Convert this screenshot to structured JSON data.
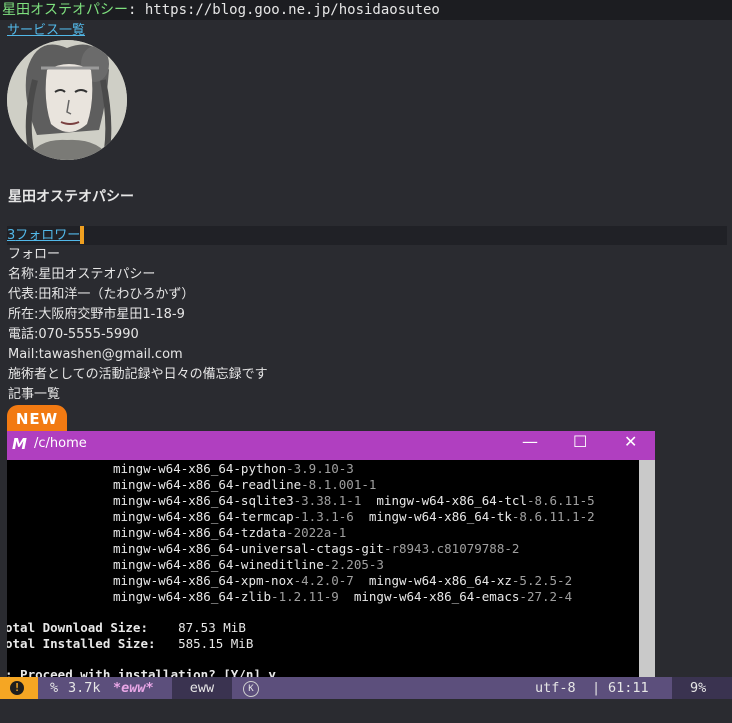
{
  "header": {
    "site_name": "星田オステオパシー",
    "separator": ": ",
    "url": "https://blog.goo.ne.jp/hosidaosuteo"
  },
  "nav": {
    "service_list_link": "サービス一覧"
  },
  "profile": {
    "blog_title": "星田オステオパシー",
    "followers_count": "3",
    "followers_label": "フォロワー",
    "follow_label": "フォロー",
    "info_lines": [
      "名称:星田オステオパシー",
      "代表:田和洋一（たわひろかず）",
      "所在:大阪府交野市星田1-18-9",
      "電話:070-5555-5990",
      "Mail:tawashen@gmail.com",
      "施術者としての活動記録や日々の備忘録です",
      "記事一覧"
    ],
    "new_badge": "NEW"
  },
  "terminal": {
    "logo": "M",
    "path": "/c/home",
    "window_buttons": {
      "minimize": "—",
      "maximize": "☐",
      "close": "✕"
    },
    "packages": [
      {
        "col1": "mingw-w64-x86_64-python",
        "ver1": "-3.9.10-3",
        "col2": "",
        "ver2": ""
      },
      {
        "col1": "mingw-w64-x86_64-readline",
        "ver1": "-8.1.001-1",
        "col2": "",
        "ver2": ""
      },
      {
        "col1": "mingw-w64-x86_64-sqlite3",
        "ver1": "-3.38.1-1",
        "col2": "mingw-w64-x86_64-tcl",
        "ver2": "-8.6.11-5"
      },
      {
        "col1": "mingw-w64-x86_64-termcap",
        "ver1": "-1.3.1-6",
        "col2": "mingw-w64-x86_64-tk",
        "ver2": "-8.6.11.1-2"
      },
      {
        "col1": "mingw-w64-x86_64-tzdata",
        "ver1": "-2022a-1",
        "col2": "",
        "ver2": ""
      },
      {
        "col1": "mingw-w64-x86_64-universal-ctags-git",
        "ver1": "-r8943.c81079788-2",
        "col2": "",
        "ver2": ""
      },
      {
        "col1": "mingw-w64-x86_64-wineditline",
        "ver1": "-2.205-3",
        "col2": "",
        "ver2": ""
      },
      {
        "col1": "mingw-w64-x86_64-xpm-nox",
        "ver1": "-4.2.0-7",
        "col2": "mingw-w64-x86_64-xz",
        "ver2": "-5.2.5-2"
      },
      {
        "col1": "mingw-w64-x86_64-zlib",
        "ver1": "-1.2.11-9",
        "col2": "mingw-w64-x86_64-emacs",
        "ver2": "-27.2-4"
      }
    ],
    "download_size_label": "otal Download Size:",
    "download_size_value": "87.53 MiB",
    "installed_size_label": "otal Installed Size:",
    "installed_size_value": "585.15 MiB",
    "prompt_line": ": Proceed with installation? [Y/n] y"
  },
  "modeline": {
    "warning_icon": "!",
    "percent_sign": "%",
    "buffer_size": "3.7k",
    "buffer_name": "*eww*",
    "mode": "eww",
    "k_badge": "K",
    "encoding": "utf-8",
    "separator": "|",
    "position": "61:11",
    "scroll_percent": "9%"
  },
  "colors": {
    "background": "#2a2b30",
    "header_bg": "#1c1d21",
    "site_name": "#7ee07e",
    "link": "#52b8e8",
    "follower_cursor": "#f0a020",
    "new_badge": "#f27a12",
    "terminal_titlebar": "#b03fc0",
    "modeline_bg": "#5c4f7c",
    "modeline_warning": "#f5a623"
  }
}
